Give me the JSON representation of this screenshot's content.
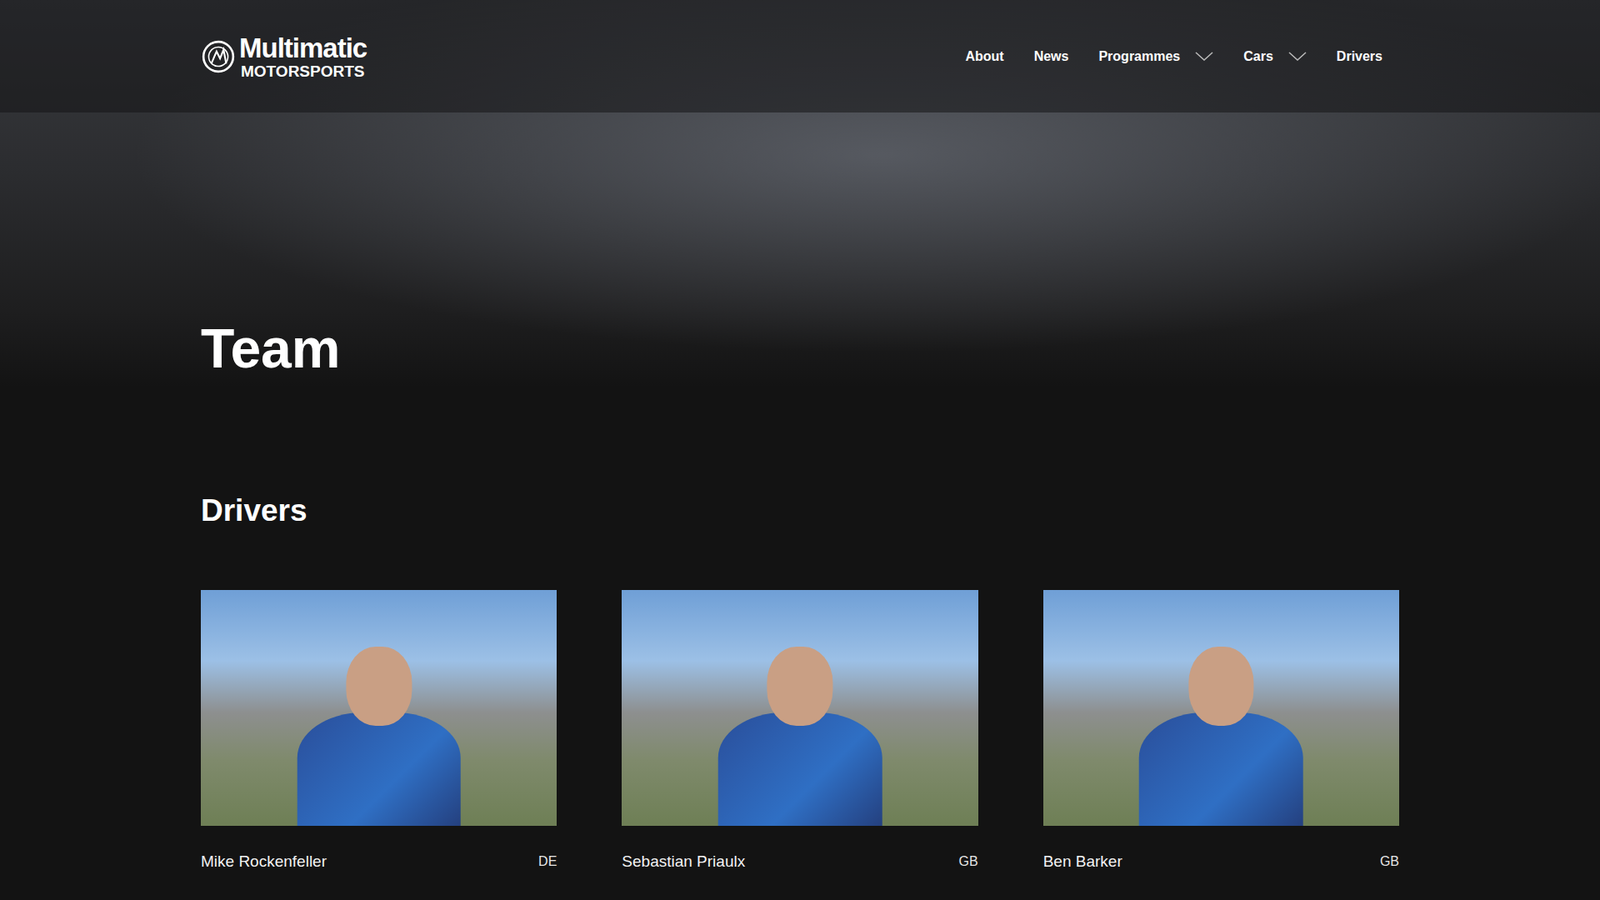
{
  "logo": {
    "name": "Multimatic",
    "subtitle": "MOTORSPORTS"
  },
  "nav": [
    {
      "label": "About",
      "has_menu": false
    },
    {
      "label": "News",
      "has_menu": false
    },
    {
      "label": "Programmes",
      "has_menu": true
    },
    {
      "label": "Cars",
      "has_menu": true
    },
    {
      "label": "Drivers",
      "has_menu": false
    }
  ],
  "hero": {
    "title": "Team"
  },
  "section": {
    "title": "Drivers"
  },
  "drivers": [
    {
      "name": "Mike Rockenfeller",
      "country": "DE"
    },
    {
      "name": "Sebastian Priaulx",
      "country": "GB"
    },
    {
      "name": "Ben Barker",
      "country": "GB"
    }
  ]
}
